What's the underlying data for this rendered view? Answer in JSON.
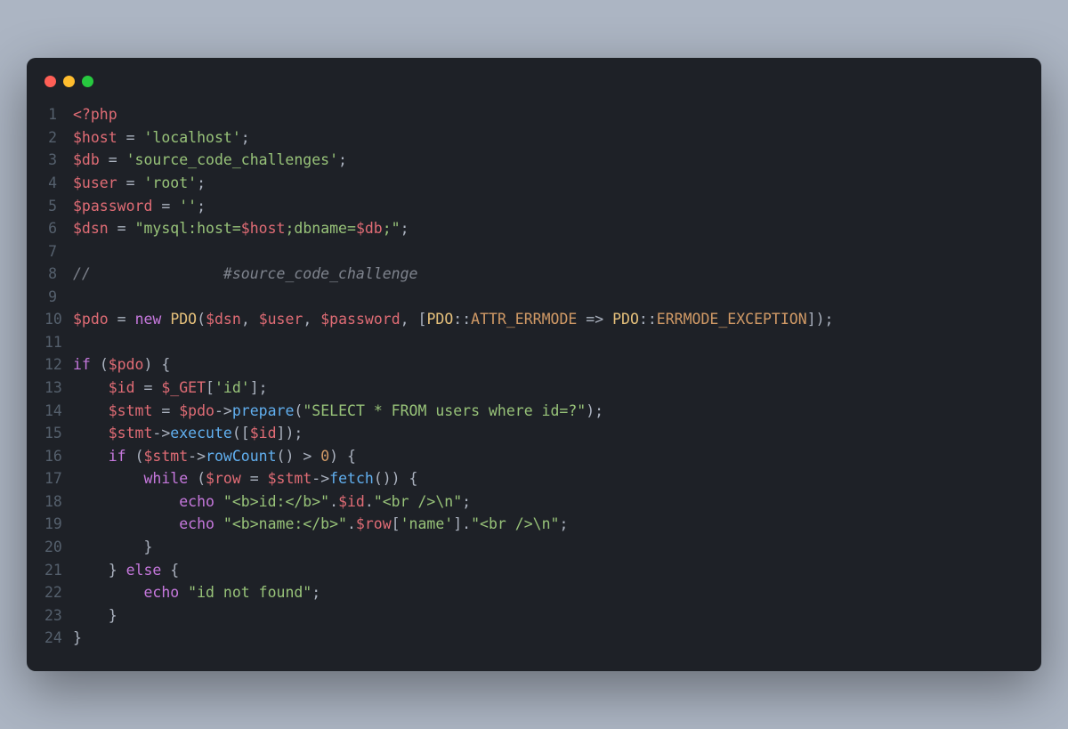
{
  "window": {
    "dots": [
      "red",
      "yellow",
      "green"
    ]
  },
  "code": {
    "lines": [
      {
        "n": "1",
        "tokens": [
          [
            "t-tag",
            "<?php"
          ]
        ]
      },
      {
        "n": "2",
        "tokens": [
          [
            "t-var",
            "$host"
          ],
          [
            "t-op",
            " = "
          ],
          [
            "t-str",
            "'localhost'"
          ],
          [
            "t-punc",
            ";"
          ]
        ]
      },
      {
        "n": "3",
        "tokens": [
          [
            "t-var",
            "$db"
          ],
          [
            "t-op",
            " = "
          ],
          [
            "t-str",
            "'source_code_challenges'"
          ],
          [
            "t-punc",
            ";"
          ]
        ]
      },
      {
        "n": "4",
        "tokens": [
          [
            "t-var",
            "$user"
          ],
          [
            "t-op",
            " = "
          ],
          [
            "t-str",
            "'root'"
          ],
          [
            "t-punc",
            ";"
          ]
        ]
      },
      {
        "n": "5",
        "tokens": [
          [
            "t-var",
            "$password"
          ],
          [
            "t-op",
            " = "
          ],
          [
            "t-str",
            "''"
          ],
          [
            "t-punc",
            ";"
          ]
        ]
      },
      {
        "n": "6",
        "tokens": [
          [
            "t-var",
            "$dsn"
          ],
          [
            "t-op",
            " = "
          ],
          [
            "t-str",
            "\"mysql:host="
          ],
          [
            "t-str-var",
            "$host"
          ],
          [
            "t-str",
            ";dbname="
          ],
          [
            "t-str-var",
            "$db"
          ],
          [
            "t-str",
            ";\""
          ],
          [
            "t-punc",
            ";"
          ]
        ]
      },
      {
        "n": "7",
        "tokens": []
      },
      {
        "n": "8",
        "tokens": [
          [
            "t-comment",
            "//               "
          ],
          [
            "t-comment",
            "#source_code_challenge"
          ]
        ]
      },
      {
        "n": "9",
        "tokens": []
      },
      {
        "n": "10",
        "tokens": [
          [
            "t-var",
            "$pdo"
          ],
          [
            "t-op",
            " = "
          ],
          [
            "t-kw",
            "new"
          ],
          [
            "t-default",
            " "
          ],
          [
            "t-class",
            "PDO"
          ],
          [
            "t-punc",
            "("
          ],
          [
            "t-var",
            "$dsn"
          ],
          [
            "t-punc",
            ", "
          ],
          [
            "t-var",
            "$user"
          ],
          [
            "t-punc",
            ", "
          ],
          [
            "t-var",
            "$password"
          ],
          [
            "t-punc",
            ", ["
          ],
          [
            "t-class",
            "PDO"
          ],
          [
            "t-punc",
            "::"
          ],
          [
            "t-const",
            "ATTR_ERRMODE"
          ],
          [
            "t-op",
            " => "
          ],
          [
            "t-class",
            "PDO"
          ],
          [
            "t-punc",
            "::"
          ],
          [
            "t-const",
            "ERRMODE_EXCEPTION"
          ],
          [
            "t-punc",
            "]);"
          ]
        ]
      },
      {
        "n": "11",
        "tokens": []
      },
      {
        "n": "12",
        "tokens": [
          [
            "t-kw",
            "if"
          ],
          [
            "t-default",
            " "
          ],
          [
            "t-punc",
            "("
          ],
          [
            "t-var",
            "$pdo"
          ],
          [
            "t-punc",
            ") {"
          ]
        ]
      },
      {
        "n": "13",
        "tokens": [
          [
            "t-default",
            "    "
          ],
          [
            "t-var",
            "$id"
          ],
          [
            "t-op",
            " = "
          ],
          [
            "t-var",
            "$_GET"
          ],
          [
            "t-punc",
            "["
          ],
          [
            "t-str",
            "'id'"
          ],
          [
            "t-punc",
            "];"
          ]
        ]
      },
      {
        "n": "14",
        "tokens": [
          [
            "t-default",
            "    "
          ],
          [
            "t-var",
            "$stmt"
          ],
          [
            "t-op",
            " = "
          ],
          [
            "t-var",
            "$pdo"
          ],
          [
            "t-punc",
            "->"
          ],
          [
            "t-func",
            "prepare"
          ],
          [
            "t-punc",
            "("
          ],
          [
            "t-str",
            "\"SELECT * FROM users where id=?\""
          ],
          [
            "t-punc",
            ");"
          ]
        ]
      },
      {
        "n": "15",
        "tokens": [
          [
            "t-default",
            "    "
          ],
          [
            "t-var",
            "$stmt"
          ],
          [
            "t-punc",
            "->"
          ],
          [
            "t-func",
            "execute"
          ],
          [
            "t-punc",
            "(["
          ],
          [
            "t-var",
            "$id"
          ],
          [
            "t-punc",
            "]);"
          ]
        ]
      },
      {
        "n": "16",
        "tokens": [
          [
            "t-default",
            "    "
          ],
          [
            "t-kw",
            "if"
          ],
          [
            "t-default",
            " "
          ],
          [
            "t-punc",
            "("
          ],
          [
            "t-var",
            "$stmt"
          ],
          [
            "t-punc",
            "->"
          ],
          [
            "t-func",
            "rowCount"
          ],
          [
            "t-punc",
            "() "
          ],
          [
            "t-op",
            ">"
          ],
          [
            "t-default",
            " "
          ],
          [
            "t-num",
            "0"
          ],
          [
            "t-punc",
            ") {"
          ]
        ]
      },
      {
        "n": "17",
        "tokens": [
          [
            "t-default",
            "        "
          ],
          [
            "t-kw",
            "while"
          ],
          [
            "t-default",
            " "
          ],
          [
            "t-punc",
            "("
          ],
          [
            "t-var",
            "$row"
          ],
          [
            "t-op",
            " = "
          ],
          [
            "t-var",
            "$stmt"
          ],
          [
            "t-punc",
            "->"
          ],
          [
            "t-func",
            "fetch"
          ],
          [
            "t-punc",
            "()) {"
          ]
        ]
      },
      {
        "n": "18",
        "tokens": [
          [
            "t-default",
            "            "
          ],
          [
            "t-kw",
            "echo"
          ],
          [
            "t-default",
            " "
          ],
          [
            "t-str",
            "\"<b>id:</b>\""
          ],
          [
            "t-punc",
            "."
          ],
          [
            "t-var",
            "$id"
          ],
          [
            "t-punc",
            "."
          ],
          [
            "t-str",
            "\"<br />\\n\""
          ],
          [
            "t-punc",
            ";"
          ]
        ]
      },
      {
        "n": "19",
        "tokens": [
          [
            "t-default",
            "            "
          ],
          [
            "t-kw",
            "echo"
          ],
          [
            "t-default",
            " "
          ],
          [
            "t-str",
            "\"<b>name:</b>\""
          ],
          [
            "t-punc",
            "."
          ],
          [
            "t-var",
            "$row"
          ],
          [
            "t-punc",
            "["
          ],
          [
            "t-str",
            "'name'"
          ],
          [
            "t-punc",
            "]."
          ],
          [
            "t-str",
            "\"<br />\\n\""
          ],
          [
            "t-punc",
            ";"
          ]
        ]
      },
      {
        "n": "20",
        "tokens": [
          [
            "t-default",
            "        "
          ],
          [
            "t-punc",
            "}"
          ]
        ]
      },
      {
        "n": "21",
        "tokens": [
          [
            "t-default",
            "    "
          ],
          [
            "t-punc",
            "} "
          ],
          [
            "t-kw",
            "else"
          ],
          [
            "t-punc",
            " {"
          ]
        ]
      },
      {
        "n": "22",
        "tokens": [
          [
            "t-default",
            "        "
          ],
          [
            "t-kw",
            "echo"
          ],
          [
            "t-default",
            " "
          ],
          [
            "t-str",
            "\"id not found\""
          ],
          [
            "t-punc",
            ";"
          ]
        ]
      },
      {
        "n": "23",
        "tokens": [
          [
            "t-default",
            "    "
          ],
          [
            "t-punc",
            "}"
          ]
        ]
      },
      {
        "n": "24",
        "tokens": [
          [
            "t-punc",
            "}"
          ]
        ]
      }
    ]
  }
}
